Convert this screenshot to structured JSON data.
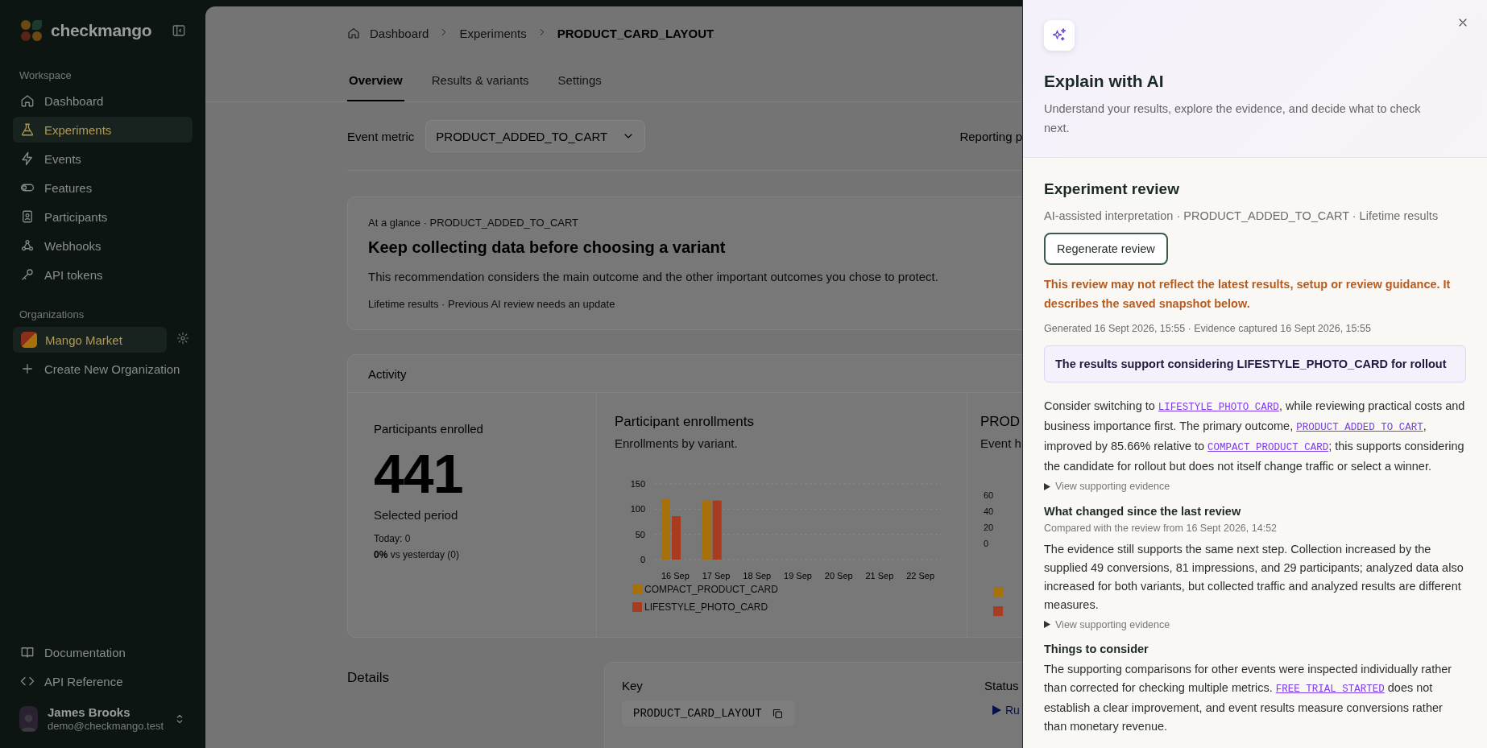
{
  "sidebar": {
    "brand": "checkmango",
    "workspace_label": "Workspace",
    "items": [
      {
        "label": "Dashboard",
        "selected": false
      },
      {
        "label": "Experiments",
        "selected": true
      },
      {
        "label": "Events",
        "selected": false
      },
      {
        "label": "Features",
        "selected": false
      },
      {
        "label": "Participants",
        "selected": false
      },
      {
        "label": "Webhooks",
        "selected": false
      },
      {
        "label": "API tokens",
        "selected": false
      }
    ],
    "organizations_label": "Organizations",
    "organizations": [
      {
        "label": "Mango Market",
        "selected": true
      }
    ],
    "create_org": "Create New Organization",
    "footer_links": [
      {
        "label": "Documentation"
      },
      {
        "label": "API Reference"
      }
    ],
    "user": {
      "name": "James Brooks",
      "email": "demo@checkmango.test"
    }
  },
  "breadcrumb": [
    "Dashboard",
    "Experiments",
    "PRODUCT_CARD_LAYOUT"
  ],
  "tabs": [
    {
      "label": "Overview",
      "selected": true
    },
    {
      "label": "Results & variants",
      "selected": false
    },
    {
      "label": "Settings",
      "selected": false
    }
  ],
  "event_metric": {
    "label": "Event metric",
    "value": "PRODUCT_ADDED_TO_CART"
  },
  "reporting_label": "Reporting p",
  "glance": {
    "eyebrow": "At a glance · PRODUCT_ADDED_TO_CART",
    "title": "Keep collecting data before choosing a variant",
    "description": "This recommendation considers the main outcome and the other important outcomes you chose to protect.",
    "footer": "Lifetime results · Previous AI review needs an update"
  },
  "activity": {
    "title": "Activity",
    "enrolled": {
      "label": "Participants enrolled",
      "value": "441",
      "period": "Selected period",
      "today": "Today: 0",
      "vs_yesterday": "**0%** vs yesterday (0)"
    },
    "enrollments_chart": {
      "title": "Participant enrollments",
      "subtitle": "Enrollments by variant.",
      "chart_data": {
        "type": "bar",
        "categories": [
          "16 Sep",
          "17 Sep",
          "18 Sep",
          "19 Sep",
          "20 Sep",
          "21 Sep",
          "22 Sep"
        ],
        "ylim": [
          0,
          150
        ],
        "yticks": [
          0,
          50,
          100,
          150
        ],
        "series": [
          {
            "name": "COMPACT_PRODUCT_CARD",
            "color": "#a8700a",
            "values": [
              120,
              118,
              0,
              0,
              0,
              0,
              0
            ]
          },
          {
            "name": "LIFESTYLE_PHOTO_CARD",
            "color": "#a83c1e",
            "values": [
              86,
              117,
              0,
              0,
              0,
              0,
              0
            ]
          }
        ]
      }
    },
    "event_chart": {
      "title": "PROD",
      "subtitle": "Event h",
      "axis_labels": [
        "60",
        "40",
        "20",
        "0"
      ],
      "legend": [
        {
          "color": "#a8700a"
        },
        {
          "color": "#a83c1e"
        }
      ]
    }
  },
  "details": {
    "title": "Details",
    "key_label": "Key",
    "key_value": "PRODUCT_CARD_LAYOUT",
    "status_label": "Status",
    "status_value": "Ru"
  },
  "ai_panel": {
    "title": "Explain with AI",
    "subtitle": "Understand your results, explore the evidence, and decide what to check next.",
    "review_title": "Experiment review",
    "meta": "AI-assisted interpretation · PRODUCT_ADDED_TO_CART · Lifetime results",
    "regenerate_button": "Regenerate review",
    "warning": "This review may not reflect the latest results, setup or review guidance. It describes the saved snapshot below.",
    "generated": "Generated 16 Sept 2026, 15:55 · Evidence captured 16 Sept 2026, 15:55",
    "verdict": "The results support considering LIFESTYLE_PHOTO_CARD for rollout",
    "sections": [
      {
        "body": [
          {
            "kind": "text",
            "text": "Consider switching to "
          },
          {
            "kind": "code",
            "text": "LIFESTYLE_PHOTO_CARD"
          },
          {
            "kind": "text",
            "text": ", while reviewing practical costs and business importance first. The primary outcome, "
          },
          {
            "kind": "code",
            "text": "PRODUCT_ADDED_TO_CART"
          },
          {
            "kind": "text",
            "text": ", improved by 85.66% relative to "
          },
          {
            "kind": "code",
            "text": "COMPACT_PRODUCT_CARD"
          },
          {
            "kind": "text",
            "text": "; this supports considering the candidate for rollout but does not itself change traffic or select a winner."
          }
        ],
        "evidence": {
          "label": "View supporting evidence",
          "expanded": false
        }
      },
      {
        "title": "What changed since the last review",
        "subtitle": "Compared with the review from 16 Sept 2026, 14:52",
        "body": [
          {
            "kind": "text",
            "text": "The evidence still supports the same next step. Collection increased by the supplied 49 conversions, 81 impressions, and 29 participants; analyzed data also increased for both variants, but collected traffic and analyzed results are different measures."
          }
        ],
        "evidence": {
          "label": "View supporting evidence",
          "expanded": false
        }
      },
      {
        "title": "Things to consider",
        "body": [
          {
            "kind": "text",
            "text": "The supporting comparisons for other events were inspected individually rather than corrected for checking multiple metrics. "
          },
          {
            "kind": "code",
            "text": "FREE_TRIAL_STARTED"
          },
          {
            "kind": "text",
            "text": " does not establish a clear improvement, and event results measure conversions rather than monetary revenue."
          }
        ]
      }
    ]
  }
}
